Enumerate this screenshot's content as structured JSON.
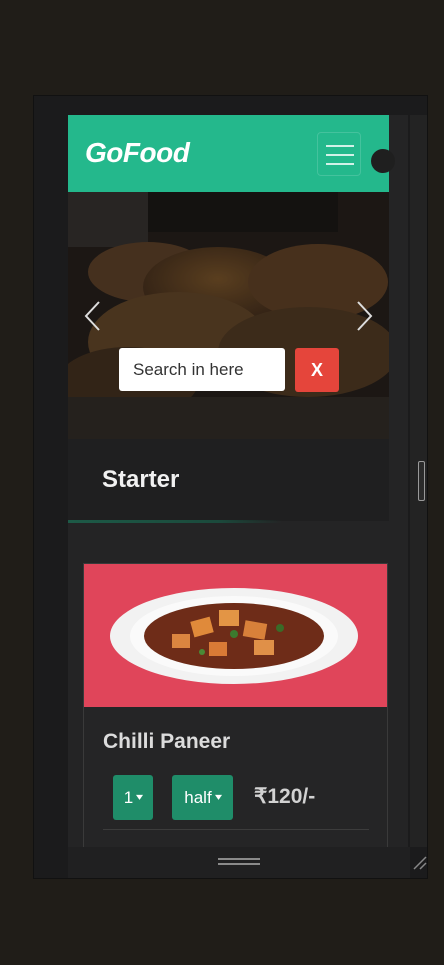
{
  "navbar": {
    "brand": "GoFood",
    "menu_icon": "hamburger-icon"
  },
  "carousel": {
    "search_placeholder": "Search in here",
    "clear_label": "X",
    "prev_icon": "chevron-left-icon",
    "next_icon": "chevron-right-icon"
  },
  "category": {
    "title": "Starter"
  },
  "items": [
    {
      "name": "Chilli Paneer",
      "quantity": "1",
      "size": "half",
      "price": "₹120/-"
    }
  ],
  "colors": {
    "accent": "#24b88c",
    "select_bg": "#1f8d69",
    "danger": "#e5453b"
  }
}
